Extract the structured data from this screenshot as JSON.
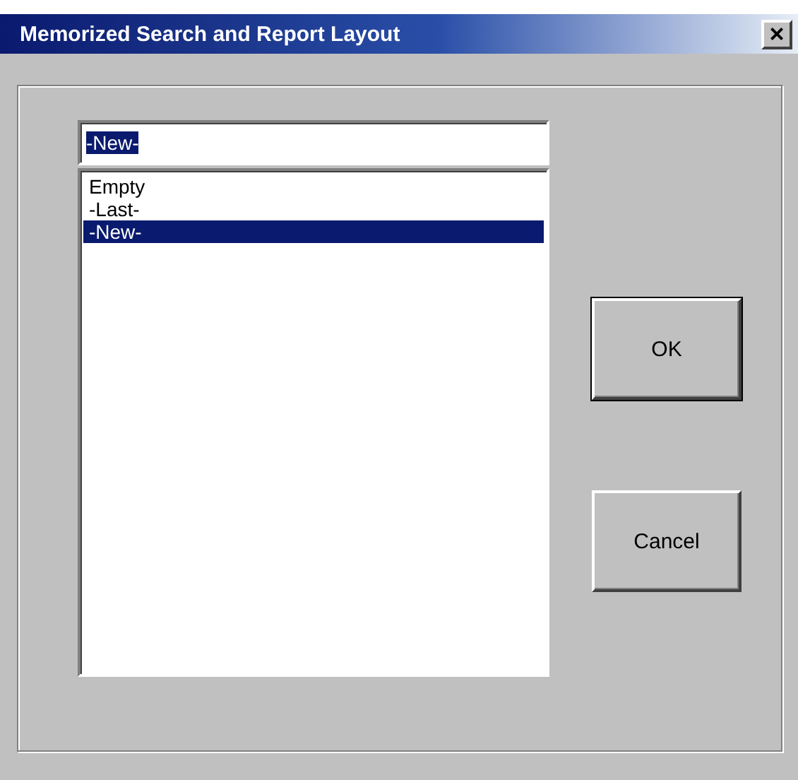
{
  "window": {
    "title": "Memorized Search and Report Layout",
    "close": "×"
  },
  "name_field": {
    "value": "-New-",
    "selected": true
  },
  "list": [
    {
      "label": "Empty",
      "selected": false
    },
    {
      "label": "-Last-",
      "selected": false
    },
    {
      "label": "-New-",
      "selected": true
    }
  ],
  "buttons": [
    {
      "label": "OK"
    },
    {
      "label": "Cancel"
    }
  ]
}
